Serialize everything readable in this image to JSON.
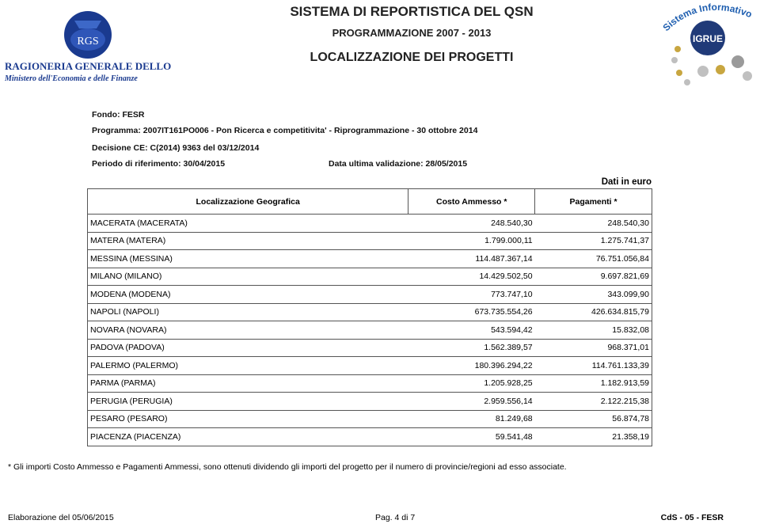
{
  "logos": {
    "left_logo_text": "RGS",
    "left_org_name": "RAGIONERIA GENERALE DELLO STATO",
    "left_org_sub": "Ministero dell'Economia e delle Finanze",
    "right_logo_text": "IGRUE",
    "right_logo_arc": "Sistema Informativo"
  },
  "header": {
    "title": "SISTEMA DI REPORTISTICA DEL QSN",
    "subtitle": "PROGRAMMAZIONE 2007 - 2013",
    "report": "LOCALIZZAZIONE DEI PROGETTI"
  },
  "info": {
    "fondo": "Fondo: FESR",
    "programma": "Programma: 2007IT161PO006  -  Pon Ricerca e competitivita' - Riprogrammazione - 30 ottobre 2014",
    "decisione": "Decisione CE: C(2014) 9363 del 03/12/2014",
    "periodo": "Periodo di riferimento:  30/04/2015",
    "validazione": "Data ultima validazione:  28/05/2015"
  },
  "unit_label": "Dati in euro",
  "table": {
    "headers": [
      "Localizzazione Geografica",
      "Costo Ammesso *",
      "Pagamenti *"
    ],
    "rows": [
      {
        "loc": "MACERATA (MACERATA)",
        "costo": "248.540,30",
        "pag": "248.540,30"
      },
      {
        "loc": "MATERA (MATERA)",
        "costo": "1.799.000,11",
        "pag": "1.275.741,37"
      },
      {
        "loc": "MESSINA (MESSINA)",
        "costo": "114.487.367,14",
        "pag": "76.751.056,84"
      },
      {
        "loc": "MILANO (MILANO)",
        "costo": "14.429.502,50",
        "pag": "9.697.821,69"
      },
      {
        "loc": "MODENA (MODENA)",
        "costo": "773.747,10",
        "pag": "343.099,90"
      },
      {
        "loc": "NAPOLI (NAPOLI)",
        "costo": "673.735.554,26",
        "pag": "426.634.815,79"
      },
      {
        "loc": "NOVARA (NOVARA)",
        "costo": "543.594,42",
        "pag": "15.832,08"
      },
      {
        "loc": "PADOVA (PADOVA)",
        "costo": "1.562.389,57",
        "pag": "968.371,01"
      },
      {
        "loc": "PALERMO (PALERMO)",
        "costo": "180.396.294,22",
        "pag": "114.761.133,39"
      },
      {
        "loc": "PARMA (PARMA)",
        "costo": "1.205.928,25",
        "pag": "1.182.913,59"
      },
      {
        "loc": "PERUGIA (PERUGIA)",
        "costo": "2.959.556,14",
        "pag": "2.122.215,38"
      },
      {
        "loc": "PESARO (PESARO)",
        "costo": "81.249,68",
        "pag": "56.874,78"
      },
      {
        "loc": "PIACENZA (PIACENZA)",
        "costo": "59.541,48",
        "pag": "21.358,19"
      }
    ]
  },
  "footnote": "* Gli importi Costo Ammesso e Pagamenti Ammessi, sono ottenuti dividendo gli importi del progetto per il numero di provincie/regioni ad esso associate.",
  "footer": {
    "elaborazione": "Elaborazione del  05/06/2015",
    "pagina": "Pag. 4 di 7",
    "codice": "CdS - 05 - FESR"
  },
  "colors": {
    "rgs_blue": "#1a3a8f",
    "igrue_blue": "#1f5fb0",
    "igrue_dark": "#203a78"
  }
}
